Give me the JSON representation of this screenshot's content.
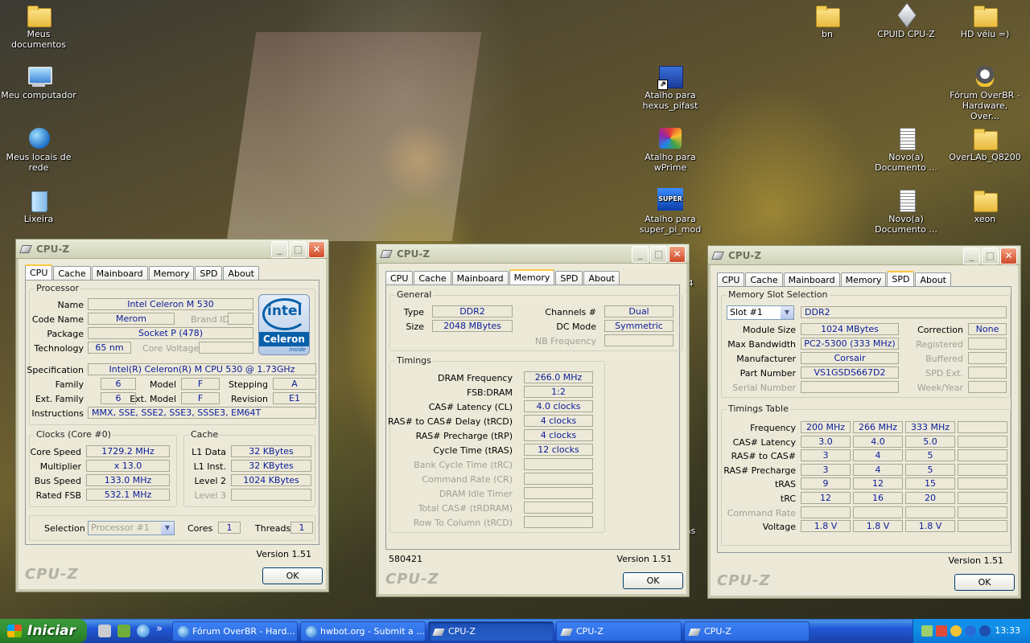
{
  "desktop": {
    "icons_left": [
      {
        "label": "Meus documentos",
        "icon": "folder-icon"
      },
      {
        "label": "Meu computador",
        "icon": "computer-icon"
      },
      {
        "label": "Meus locais de rede",
        "icon": "network-globe-icon"
      },
      {
        "label": "Lixeira",
        "icon": "recycle-bin-icon"
      }
    ],
    "icons_mid": [
      {
        "label": "Atalho para hexus_pifast",
        "icon": "shortcut-icon"
      },
      {
        "label": "Atalho para wPrime",
        "icon": "wprime-icon"
      },
      {
        "label": "Atalho para super_pi_mod",
        "icon": "superpi-icon"
      }
    ],
    "icons_right": [
      {
        "label": "bn",
        "icon": "folder-icon"
      },
      {
        "label": "CPUID CPU-Z",
        "icon": "cpuz-icon"
      },
      {
        "label": "HD véiu =)",
        "icon": "folder-icon"
      },
      {
        "label": "Fórum OverBR - Hardware, Over...",
        "icon": "forum-icon"
      },
      {
        "label": "Novo(a) Documento ...",
        "icon": "document-icon"
      },
      {
        "label": "OverLAb_Q8200",
        "icon": "folder-icon"
      },
      {
        "label": "Novo(a) Documento ...",
        "icon": "document-icon"
      },
      {
        "label": "xeon",
        "icon": "folder-icon"
      }
    ],
    "stray_text": [
      "4",
      "hs"
    ]
  },
  "tabs": [
    "CPU",
    "Cache",
    "Mainboard",
    "Memory",
    "SPD",
    "About"
  ],
  "win1": {
    "title": "CPU-Z",
    "active_tab": "CPU",
    "processor": {
      "group": "Processor",
      "name_label": "Name",
      "name": "Intel Celeron M 530",
      "codename_label": "Code Name",
      "codename": "Merom",
      "brandid_label": "Brand ID",
      "brandid": "",
      "package_label": "Package",
      "package": "Socket P (478)",
      "technology_label": "Technology",
      "technology": "65 nm",
      "corevoltage_label": "Core Voltage",
      "corevoltage": "",
      "spec_label": "Specification",
      "spec": "Intel(R) Celeron(R) M CPU       530  @ 1.73GHz",
      "family_label": "Family",
      "family": "6",
      "model_label": "Model",
      "model": "F",
      "stepping_label": "Stepping",
      "stepping": "A",
      "extfamily_label": "Ext. Family",
      "extfamily": "6",
      "extmodel_label": "Ext. Model",
      "extmodel": "F",
      "revision_label": "Revision",
      "revision": "E1",
      "instructions_label": "Instructions",
      "instructions": "MMX, SSE, SSE2, SSE3, SSSE3, EM64T",
      "logo": {
        "brand": "intel",
        "product": "Celeron",
        "tag": "inside"
      }
    },
    "clocks": {
      "group": "Clocks (Core #0)",
      "corespeed_label": "Core Speed",
      "corespeed": "1729.2 MHz",
      "multiplier_label": "Multiplier",
      "multiplier": "x 13.0",
      "busspeed_label": "Bus Speed",
      "busspeed": "133.0 MHz",
      "ratedfsb_label": "Rated FSB",
      "ratedfsb": "532.1 MHz"
    },
    "cache": {
      "group": "Cache",
      "l1data_label": "L1 Data",
      "l1data": "32 KBytes",
      "l1inst_label": "L1 Inst.",
      "l1inst": "32 KBytes",
      "level2_label": "Level 2",
      "level2": "1024 KBytes",
      "level3_label": "Level 3",
      "level3": ""
    },
    "selection": {
      "selection_label": "Selection",
      "selection_value": "Processor #1",
      "cores_label": "Cores",
      "cores": "1",
      "threads_label": "Threads",
      "threads": "1"
    },
    "version": "Version 1.51",
    "brand": "CPU-Z",
    "ok": "OK"
  },
  "win2": {
    "title": "CPU-Z",
    "active_tab": "Memory",
    "general": {
      "group": "General",
      "type_label": "Type",
      "type": "DDR2",
      "size_label": "Size",
      "size": "2048 MBytes",
      "channels_label": "Channels #",
      "channels": "Dual",
      "dcmode_label": "DC Mode",
      "dcmode": "Symmetric",
      "nbfreq_label": "NB Frequency",
      "nbfreq": ""
    },
    "timings": {
      "group": "Timings",
      "rows": [
        {
          "label": "DRAM Frequency",
          "value": "266.0 MHz",
          "dim": false
        },
        {
          "label": "FSB:DRAM",
          "value": "1:2",
          "dim": false
        },
        {
          "label": "CAS# Latency (CL)",
          "value": "4.0 clocks",
          "dim": false
        },
        {
          "label": "RAS# to CAS# Delay (tRCD)",
          "value": "4 clocks",
          "dim": false
        },
        {
          "label": "RAS# Precharge (tRP)",
          "value": "4 clocks",
          "dim": false
        },
        {
          "label": "Cycle Time (tRAS)",
          "value": "12 clocks",
          "dim": false
        },
        {
          "label": "Bank Cycle Time (tRC)",
          "value": "",
          "dim": true
        },
        {
          "label": "Command Rate (CR)",
          "value": "",
          "dim": true
        },
        {
          "label": "DRAM Idle Timer",
          "value": "",
          "dim": true
        },
        {
          "label": "Total CAS# (tRDRAM)",
          "value": "",
          "dim": true
        },
        {
          "label": "Row To Column (tRCD)",
          "value": "",
          "dim": true
        }
      ]
    },
    "footer_id": "580421",
    "version": "Version 1.51",
    "brand": "CPU-Z",
    "ok": "OK"
  },
  "win3": {
    "title": "CPU-Z",
    "active_tab": "SPD",
    "slot": {
      "group": "Memory Slot Selection",
      "slot_value": "Slot #1",
      "type": "DDR2",
      "modulesize_label": "Module Size",
      "modulesize": "1024 MBytes",
      "maxbw_label": "Max Bandwidth",
      "maxbw": "PC2-5300 (333 MHz)",
      "manufacturer_label": "Manufacturer",
      "manufacturer": "Corsair",
      "partnumber_label": "Part Number",
      "partnumber": "VS1GSDS667D2",
      "serial_label": "Serial Number",
      "serial": "",
      "correction_label": "Correction",
      "correction": "None",
      "registered_label": "Registered",
      "registered": "",
      "buffered_label": "Buffered",
      "buffered": "",
      "spdext_label": "SPD Ext.",
      "spdext": "",
      "weekyear_label": "Week/Year",
      "weekyear": ""
    },
    "timings_table": {
      "group": "Timings Table",
      "rows": [
        {
          "label": "Frequency",
          "values": [
            "200 MHz",
            "266 MHz",
            "333 MHz",
            ""
          ],
          "dim": false
        },
        {
          "label": "CAS# Latency",
          "values": [
            "3.0",
            "4.0",
            "5.0",
            ""
          ],
          "dim": false
        },
        {
          "label": "RAS# to CAS#",
          "values": [
            "3",
            "4",
            "5",
            ""
          ],
          "dim": false
        },
        {
          "label": "RAS# Precharge",
          "values": [
            "3",
            "4",
            "5",
            ""
          ],
          "dim": false
        },
        {
          "label": "tRAS",
          "values": [
            "9",
            "12",
            "15",
            ""
          ],
          "dim": false
        },
        {
          "label": "tRC",
          "values": [
            "12",
            "16",
            "20",
            ""
          ],
          "dim": false
        },
        {
          "label": "Command Rate",
          "values": [
            "",
            "",
            "",
            ""
          ],
          "dim": true
        },
        {
          "label": "Voltage",
          "values": [
            "1.8 V",
            "1.8 V",
            "1.8 V",
            ""
          ],
          "dim": false
        }
      ]
    },
    "version": "Version 1.51",
    "brand": "CPU-Z",
    "ok": "OK"
  },
  "taskbar": {
    "start_label": "Iniciar",
    "quicklaunch_more": "»",
    "buttons": [
      {
        "label": "Fórum OverBR - Hard...",
        "icon": "ie-icon",
        "active": false
      },
      {
        "label": "hwbot.org - Submit a ...",
        "icon": "ie-icon",
        "active": false
      },
      {
        "label": "CPU-Z",
        "icon": "cpuz-icon",
        "active": true
      },
      {
        "label": "CPU-Z",
        "icon": "cpuz-icon",
        "active": false
      },
      {
        "label": "CPU-Z",
        "icon": "cpuz-icon",
        "active": false
      }
    ],
    "clock": "13:33"
  }
}
